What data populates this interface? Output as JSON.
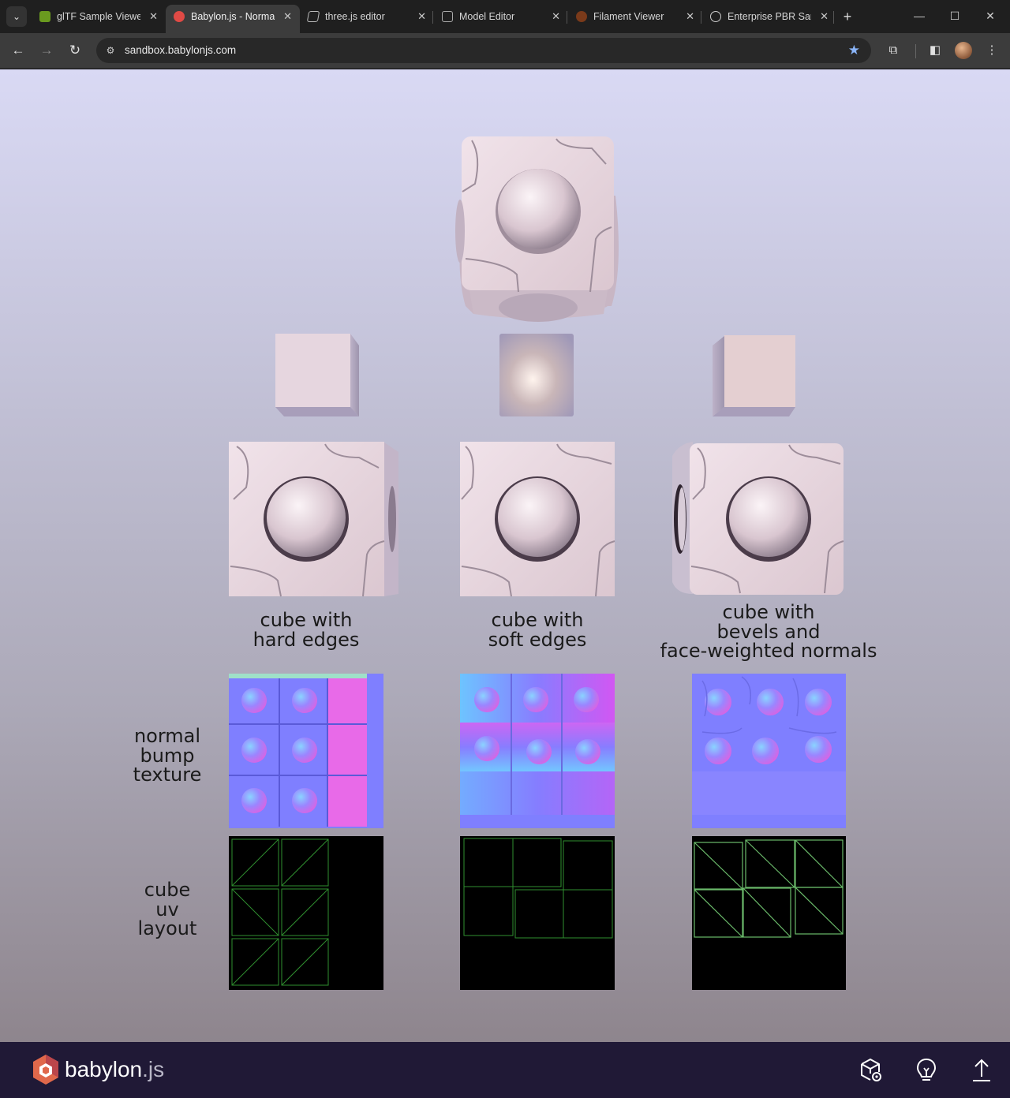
{
  "browser": {
    "tabs": [
      {
        "title": "glTF Sample Viewer",
        "favicon": "gltf-icon",
        "active": false
      },
      {
        "title": "Babylon.js - Normals",
        "favicon": "babylon-icon",
        "active": true
      },
      {
        "title": "three.js editor",
        "favicon": "threejs-icon",
        "active": false
      },
      {
        "title": "Model Editor",
        "favicon": "cube-icon",
        "active": false
      },
      {
        "title": "Filament Viewer",
        "favicon": "filament-icon",
        "active": false
      },
      {
        "title": "Enterprise PBR Sample",
        "favicon": "globe-icon",
        "active": false
      }
    ],
    "url": "sandbox.babylonjs.com",
    "bookmarked": true
  },
  "scene": {
    "columns": [
      {
        "label_lines": [
          "cube with",
          "hard edges"
        ]
      },
      {
        "label_lines": [
          "cube with",
          "soft edges"
        ]
      },
      {
        "label_lines": [
          "cube with",
          "bevels and",
          "face-weighted normals"
        ]
      }
    ],
    "row_labels": {
      "normal_bump": [
        "normal",
        "bump",
        "texture"
      ],
      "uv_layout": [
        "cube",
        "uv",
        "layout"
      ]
    },
    "colors": {
      "bg_top": "#d9d9f4",
      "bg_bottom": "#8e858d",
      "cube_face": "#e7d3db",
      "normal_map_base": "#7f7fff",
      "uv_line": "#2f8f2f"
    }
  },
  "footer": {
    "brand_main": "babylon",
    "brand_suffix": ".js",
    "icons": [
      "inspector-icon",
      "lightbulb-icon",
      "upload-icon"
    ],
    "accent": "#201936"
  }
}
